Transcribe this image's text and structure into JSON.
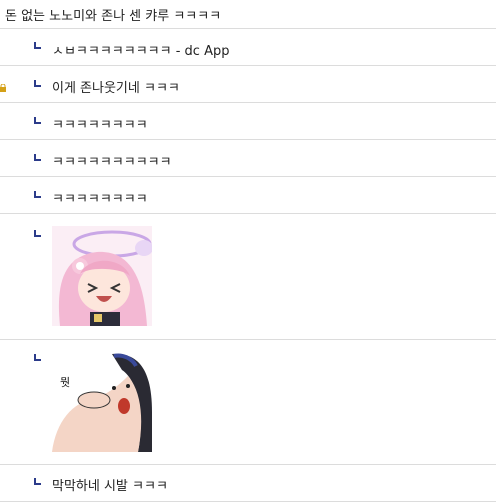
{
  "thread": {
    "title": "돈 없는 노노미와 존나 센 캬루 ㅋㅋㅋㅋ"
  },
  "replies": [
    {
      "text": "ㅅㅂㅋㅋㅋㅋㅋㅋㅋㅋ - dc App"
    },
    {
      "text": "이게 존나웃기네 ㅋㅋㅋ"
    },
    {
      "text": "ㅋㅋㅋㅋㅋㅋㅋㅋ"
    },
    {
      "text": "ㅋㅋㅋㅋㅋㅋㅋㅋㅋㅋ"
    },
    {
      "text": "ㅋㅋㅋㅋㅋㅋㅋㅋ"
    },
    {
      "image": "laughing-pink-hair-girl-sticker"
    },
    {
      "image": "big-nose-face-sticker",
      "image_text": "뭣"
    },
    {
      "text": "막막하네 시발 ㅋㅋㅋ"
    }
  ],
  "colors": {
    "reply_mark": "#2b3b8a",
    "divider": "#dcdcdc"
  }
}
